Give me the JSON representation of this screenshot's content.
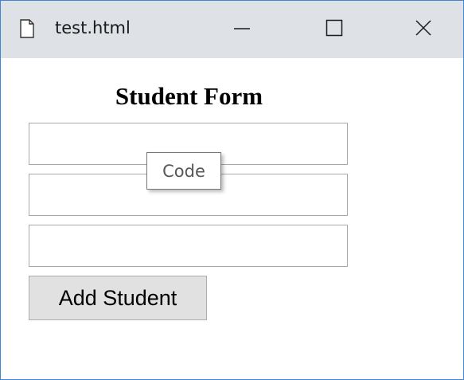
{
  "window": {
    "title": "test.html",
    "accent_color": "#3c87d6",
    "titlebar_color": "#dee1e6",
    "controls": [
      "minimize-icon",
      "maximize-icon",
      "close-icon"
    ]
  },
  "form": {
    "heading": "Student Form",
    "fields": [
      {
        "value": "",
        "placeholder": ""
      },
      {
        "value": "",
        "placeholder": ""
      },
      {
        "value": "",
        "placeholder": ""
      }
    ],
    "submit_label": "Add Student"
  },
  "tooltip": {
    "text": "Code"
  }
}
